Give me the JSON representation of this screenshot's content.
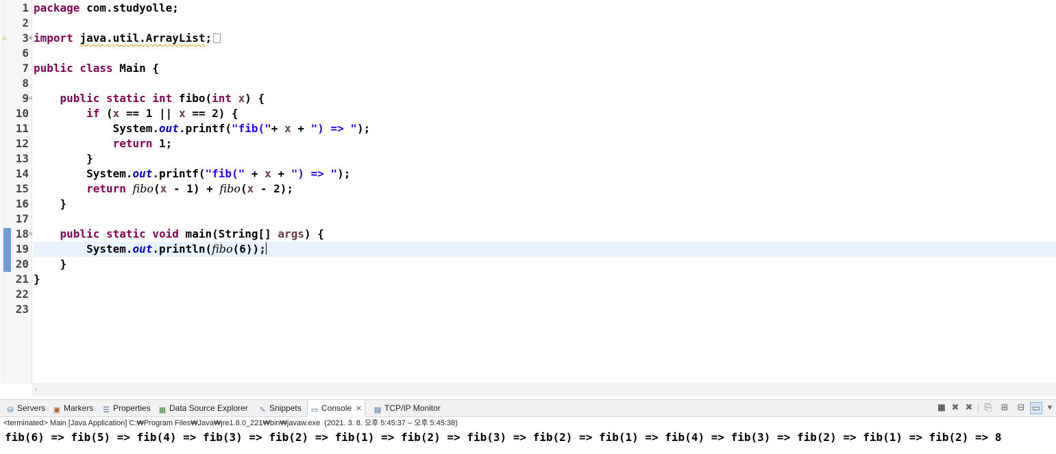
{
  "editor": {
    "line_numbers": [
      "1",
      "2",
      "3",
      "6",
      "7",
      "8",
      "9",
      "10",
      "11",
      "12",
      "13",
      "14",
      "15",
      "16",
      "17",
      "18",
      "19",
      "20",
      "21",
      "22",
      "23"
    ],
    "code": {
      "l1_kw": "package",
      "l1_rest": " com.studyolle;",
      "l3_kw": "import",
      "l3_pkg": "java.util.ArrayList",
      "l3_semi": ";",
      "l7_kw": "public class",
      "l7_rest": " Main {",
      "l9_kw": "public static int",
      "l9_name": " fibo(",
      "l9_kw2": "int",
      "l9_param": " x",
      "l9_end": ") {",
      "l10_kw": "if",
      "l10_a": " (",
      "l10_x1": "x",
      "l10_b": " == 1 || ",
      "l10_x2": "x",
      "l10_c": " == 2) {",
      "l11_a": "System.",
      "l11_out": "out",
      "l11_b": ".printf(",
      "l11_s1": "\"fib(\"",
      "l11_c": "+ ",
      "l11_x": "x",
      "l11_d": " + ",
      "l11_s2": "\") => \"",
      "l11_e": ");",
      "l12_kw": "return",
      "l12_rest": " 1;",
      "l13": "}",
      "l14_a": "System.",
      "l14_out": "out",
      "l14_b": ".printf(",
      "l14_s1": "\"fib(\"",
      "l14_c": " + ",
      "l14_x": "x",
      "l14_d": " + ",
      "l14_s2": "\") => \"",
      "l14_e": ");",
      "l15_kw": "return",
      "l15_f1": "fibo",
      "l15_a": "(",
      "l15_x1": "x",
      "l15_b": " - 1) + ",
      "l15_f2": "fibo",
      "l15_c": "(",
      "l15_x2": "x",
      "l15_d": " - 2);",
      "l16": "}",
      "l18_kw": "public static void",
      "l18_a": " main(String[] ",
      "l18_args": "args",
      "l18_b": ") {",
      "l19_a": "System.",
      "l19_out": "out",
      "l19_b": ".println(",
      "l19_f": "fibo",
      "l19_c": "(6));",
      "l20": "}",
      "l21": "}"
    }
  },
  "console_view": {
    "tabs": [
      "Servers",
      "Markers",
      "Properties",
      "Data Source Explorer",
      "Snippets",
      "Console",
      "TCP/IP Monitor"
    ],
    "active_tab": "Console",
    "status": "<terminated> Main [Java Application] C:₩Program Files₩Java₩jre1.8.0_221₩bin₩javaw.exe  (2021. 3. 8. 오후 5:45:37 – 오후 5:45:38)",
    "output": "fib(6) => fib(5) => fib(4) => fib(3) => fib(2) => fib(1) => fib(2) => fib(3) => fib(2) => fib(1) => fib(4) => fib(3) => fib(2) => fib(1) => fib(2) => 8",
    "toolbar_icons": [
      "terminate-icon",
      "remove-launch-icon",
      "remove-all-icon",
      "scroll-lock-icon",
      "clear-console-icon",
      "pin-console-icon",
      "display-console-icon"
    ]
  },
  "colors": {
    "keyword": "#7f0055",
    "string": "#2a00ff",
    "field": "#0000c0",
    "parameter": "#6a3e3e",
    "current_line": "#e8f2fe"
  }
}
